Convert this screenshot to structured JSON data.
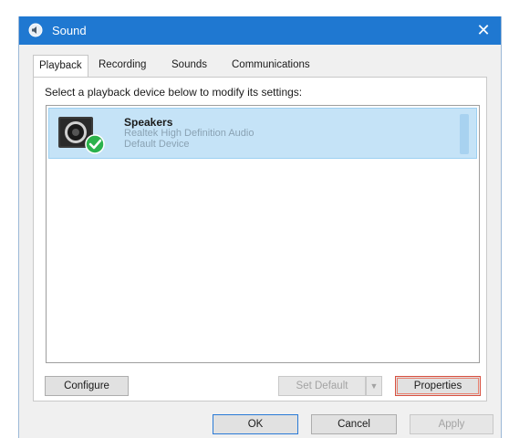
{
  "window": {
    "title": "Sound",
    "close_glyph": "✕"
  },
  "tabs": [
    {
      "label": "Playback",
      "active": true
    },
    {
      "label": "Recording",
      "active": false
    },
    {
      "label": "Sounds",
      "active": false
    },
    {
      "label": "Communications",
      "active": false
    }
  ],
  "playback": {
    "instruction": "Select a playback device below to modify its settings:",
    "devices": [
      {
        "name": "Speakers",
        "driver": "Realtek High Definition Audio",
        "status": "Default Device",
        "icon": "speaker-icon",
        "default_badge": "check-icon",
        "selected": true
      }
    ],
    "buttons": {
      "configure": "Configure",
      "set_default": "Set Default",
      "set_default_arrow": "▼",
      "properties": "Properties"
    }
  },
  "dialog_buttons": {
    "ok": "OK",
    "cancel": "Cancel",
    "apply": "Apply"
  },
  "colors": {
    "titlebar": "#1f78d1",
    "selection": "#c5e3f7",
    "focus_border": "#d85040",
    "default_badge": "#2bb24c"
  }
}
